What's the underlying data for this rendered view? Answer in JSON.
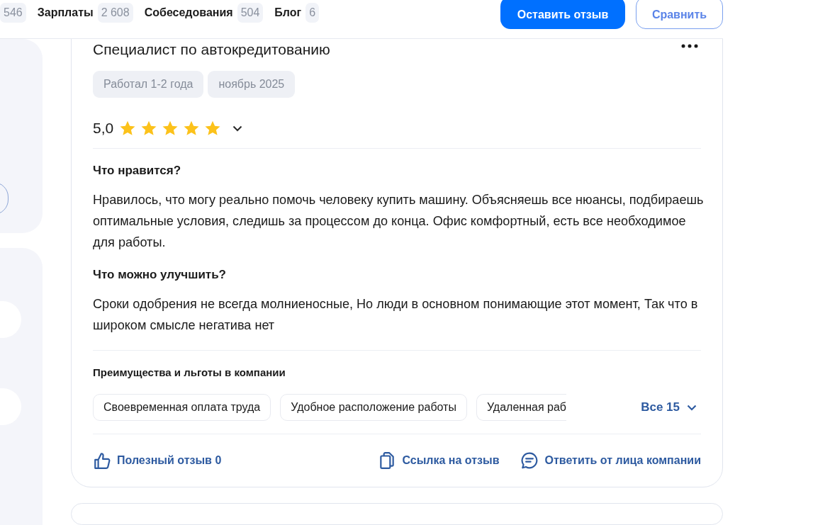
{
  "nav": {
    "tabs": [
      {
        "count": "546"
      },
      {
        "label": "Зарплаты",
        "count": "2 608"
      },
      {
        "label": "Собеседования",
        "count": "504"
      },
      {
        "label": "Блог",
        "count": "6"
      }
    ],
    "buttons": [
      {
        "label": "Оставить отзыв",
        "kind": "primary"
      },
      {
        "label": "Сравнить",
        "kind": "outline"
      }
    ]
  },
  "review": {
    "title": "Специалист по автокредитованию",
    "tags": [
      "Работал 1-2 года",
      "ноябрь 2025"
    ],
    "rating": {
      "value": "5,0",
      "stars": 5
    },
    "sections": [
      {
        "heading": "Что нравится?",
        "text": "Нравилось, что могу реально помочь человеку купить машину. Объясняешь все нюансы, подбираешь оптимальные условия, следишь за процессом до конца. Офис комфортный, есть все необходимое для работы."
      },
      {
        "heading": "Что можно улучшить?",
        "text": "Сроки одобрения не всегда молниеносные, Но люди в основном понимающие этот момент, Так что в широком смысле негатива нет"
      }
    ],
    "benefits": {
      "heading": "Преимущества и льготы в компании",
      "items": [
        "Своевременная оплата труда",
        "Удобное расположение работы",
        "Удаленная раб"
      ],
      "more": "Все 15"
    },
    "actions": [
      {
        "label": "Полезный отзыв 0",
        "kind": "thumb"
      },
      {
        "label": "Ссылка на отзыв",
        "kind": "copy"
      },
      {
        "label": "Ответить от лица компании",
        "kind": "chat"
      }
    ]
  }
}
